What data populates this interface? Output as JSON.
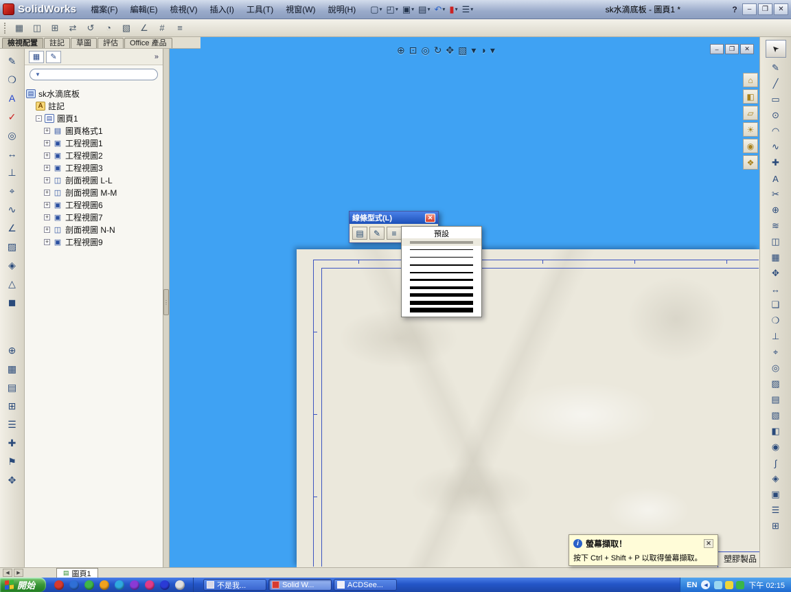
{
  "colors": {
    "viewport_blue": "#3fa2f3",
    "paper": "#ebe8dc",
    "frame_line": "#3b53c0",
    "taskbar_blue": "#2456c8",
    "start_green": "#3a9638",
    "dialog_caption_blue": "#1c50b8",
    "notification_yellow": "#fffcd8"
  },
  "glyphs": {
    "caret": "▾",
    "expand": "+",
    "collapse": "-",
    "chevrons": "»",
    "funnel": "▼",
    "doc_icon": "▤",
    "sheet_icon": "▤",
    "annotations_icon": "A",
    "fm_tab1": "▦",
    "fm_tab2": "✎",
    "cursor": "➤",
    "grip_dots": "⋮",
    "info": "i",
    "tray_chevron": "◀",
    "nav_left": "◀",
    "nav_right": "▶"
  },
  "app": {
    "brand": "SolidWorks",
    "window_title": "sk水滴底板 - 圖頁1 *",
    "help": "?"
  },
  "window_controls": {
    "minimize": "–",
    "restore": "❐",
    "close": "✕"
  },
  "menu": [
    "檔案(F)",
    "編輯(E)",
    "檢視(V)",
    "插入(I)",
    "工具(T)",
    "視窗(W)",
    "說明(H)"
  ],
  "titlebar_tools": [
    {
      "name": "new-document",
      "glyph": "▢"
    },
    {
      "name": "open-document",
      "glyph": "◰"
    },
    {
      "name": "save-document",
      "glyph": "▣"
    },
    {
      "name": "print-document",
      "glyph": "▤"
    },
    {
      "name": "undo",
      "glyph": "↶",
      "color": "#2a62c8"
    },
    {
      "name": "rebuild",
      "glyph": "▮",
      "color": "#cc2222"
    },
    {
      "name": "options",
      "glyph": "☰"
    }
  ],
  "toolbar2": [
    {
      "name": "grid",
      "glyph": "▦"
    },
    {
      "name": "picture",
      "glyph": "◫"
    },
    {
      "name": "table",
      "glyph": "⊞"
    },
    {
      "name": "swap-arrows",
      "glyph": "⇄"
    },
    {
      "name": "rotate",
      "glyph": "↺"
    },
    {
      "name": "arc-tool",
      "glyph": "◔"
    },
    {
      "name": "hatch",
      "glyph": "▧"
    },
    {
      "name": "angle",
      "glyph": "∠"
    },
    {
      "name": "numbering",
      "glyph": "#"
    },
    {
      "name": "list",
      "glyph": "≡"
    }
  ],
  "command_tabs": [
    {
      "label": "檢視配置",
      "active": true
    },
    {
      "label": "註記"
    },
    {
      "label": "草圖"
    },
    {
      "label": "評估"
    },
    {
      "label": "Office 產品"
    }
  ],
  "left_toolbar_top": [
    {
      "name": "note",
      "glyph": "✎"
    },
    {
      "name": "balloon",
      "glyph": "❍"
    },
    {
      "name": "text",
      "glyph": "A",
      "color": "#2244cc"
    },
    {
      "name": "spellcheck",
      "glyph": "✓",
      "color": "#cc2222"
    },
    {
      "name": "magnifier",
      "glyph": "◎"
    },
    {
      "name": "dimension",
      "glyph": "↔"
    },
    {
      "name": "datum",
      "glyph": "⊥"
    },
    {
      "name": "tolerance",
      "glyph": "⌖"
    },
    {
      "name": "surface-finish",
      "glyph": "∿"
    },
    {
      "name": "weld-symbol",
      "glyph": "∠"
    },
    {
      "name": "area-hatch",
      "glyph": "▨"
    },
    {
      "name": "block",
      "glyph": "◈"
    },
    {
      "name": "datum-triangle",
      "glyph": "△"
    },
    {
      "name": "fill",
      "glyph": "◼"
    }
  ],
  "left_toolbar_bottom": [
    {
      "name": "center-mark",
      "glyph": "⊕"
    },
    {
      "name": "general-table",
      "glyph": "▦"
    },
    {
      "name": "revision-table",
      "glyph": "▤"
    },
    {
      "name": "hole-table",
      "glyph": "⊞"
    },
    {
      "name": "bom-table",
      "glyph": "☰"
    },
    {
      "name": "pin",
      "glyph": "✚"
    },
    {
      "name": "flag",
      "glyph": "⚑"
    },
    {
      "name": "move",
      "glyph": "✥"
    }
  ],
  "right_toolbar": [
    {
      "name": "sketch",
      "glyph": "✎"
    },
    {
      "name": "line",
      "glyph": "╱"
    },
    {
      "name": "rectangle",
      "glyph": "▭"
    },
    {
      "name": "circle",
      "glyph": "⊙"
    },
    {
      "name": "arc",
      "glyph": "◠"
    },
    {
      "name": "spline",
      "glyph": "∿"
    },
    {
      "name": "point",
      "glyph": "✚"
    },
    {
      "name": "text",
      "glyph": "A"
    },
    {
      "name": "trim",
      "glyph": "✂"
    },
    {
      "name": "convert-entities",
      "glyph": "⊕"
    },
    {
      "name": "offset",
      "glyph": "≋"
    },
    {
      "name": "mirror",
      "glyph": "◫"
    },
    {
      "name": "linear-pattern",
      "glyph": "▦"
    },
    {
      "name": "move-entities",
      "glyph": "✥"
    },
    {
      "name": "smart-dimension",
      "glyph": "↔"
    },
    {
      "name": "note",
      "glyph": "❑"
    },
    {
      "name": "balloon",
      "glyph": "❍"
    },
    {
      "name": "datum-feature",
      "glyph": "⊥"
    },
    {
      "name": "geometric-tolerance",
      "glyph": "⌖"
    },
    {
      "name": "center-mark",
      "glyph": "◎"
    },
    {
      "name": "area-hatch",
      "glyph": "▨"
    },
    {
      "name": "tables",
      "glyph": "▤"
    },
    {
      "name": "model-view",
      "glyph": "▧"
    },
    {
      "name": "section-view",
      "glyph": "◧"
    },
    {
      "name": "detail-view",
      "glyph": "◉"
    },
    {
      "name": "break-view",
      "glyph": "∫"
    },
    {
      "name": "block",
      "glyph": "◈"
    },
    {
      "name": "revision",
      "glyph": "▣"
    },
    {
      "name": "layers",
      "glyph": "☰"
    },
    {
      "name": "grid-settings",
      "glyph": "⊞"
    }
  ],
  "minibar": [
    {
      "name": "home",
      "glyph": "⌂"
    },
    {
      "name": "display-style",
      "glyph": "◧"
    },
    {
      "name": "folder",
      "glyph": "▱"
    },
    {
      "name": "lighting",
      "glyph": "☀"
    },
    {
      "name": "material",
      "glyph": "◉"
    },
    {
      "name": "appearance",
      "glyph": "❖"
    }
  ],
  "viewtools": [
    {
      "name": "zoom-in",
      "glyph": "⊕"
    },
    {
      "name": "zoom-area",
      "glyph": "⊡"
    },
    {
      "name": "zoom-fit",
      "glyph": "◎"
    },
    {
      "name": "rotate-view",
      "glyph": "↻"
    },
    {
      "name": "pan",
      "glyph": "✥"
    },
    {
      "name": "view-orientation",
      "glyph": "▧"
    },
    {
      "name": "view-orientation-caret",
      "glyph": "▾"
    },
    {
      "name": "display-style",
      "glyph": "◑"
    },
    {
      "name": "display-style-caret",
      "glyph": "▾"
    }
  ],
  "tree": {
    "root": "sk水滴底板",
    "annotations": "註記",
    "sheet": "圖頁1",
    "children": [
      {
        "label": "圖頁格式1",
        "glyph": "▤"
      },
      {
        "label": "工程視圖1",
        "glyph": "▣"
      },
      {
        "label": "工程視圖2",
        "glyph": "▣"
      },
      {
        "label": "工程視圖3",
        "glyph": "▣"
      },
      {
        "label": "剖面視圖 L-L",
        "glyph": "◫"
      },
      {
        "label": "剖面視圖 M-M",
        "glyph": "◫"
      },
      {
        "label": "工程視圖6",
        "glyph": "▣"
      },
      {
        "label": "工程視圖7",
        "glyph": "▣"
      },
      {
        "label": "剖面視圖 N-N",
        "glyph": "◫"
      },
      {
        "label": "工程視圖9",
        "glyph": "▣"
      }
    ]
  },
  "line_style": {
    "title": "線條型式(L)",
    "close": "✕",
    "buttons": [
      {
        "name": "layer-properties",
        "glyph": "▤"
      },
      {
        "name": "line-color",
        "glyph": "✎"
      },
      {
        "name": "line-thickness",
        "glyph": "≡"
      }
    ],
    "dropdown_header": "預設",
    "weights": [
      {
        "h": 4,
        "default": true
      },
      1,
      1,
      2,
      2,
      3,
      4,
      5,
      6,
      7
    ]
  },
  "notification": {
    "title": "螢幕擷取！",
    "body": "按下 Ctrl + Shift + P 以取得螢幕擷取。",
    "close": "✕"
  },
  "sheet_area": {
    "title_block": "塑膠製品"
  },
  "sheet_strip": {
    "tab": "圖頁1"
  },
  "taskbar": {
    "start": "開始",
    "quick_launch": [
      "#d63a2f",
      "#2f6fd6",
      "#3fb54a",
      "#f0a21e",
      "#2fa9e0",
      "#8a3ad6",
      "#e03a8a",
      "#2a3ad6",
      "#e0e0e0"
    ],
    "tasks": [
      {
        "label": "不是我...",
        "color": "#d8d8e8"
      },
      {
        "label": "Solid W...",
        "color": "#d63a2f",
        "active": true
      },
      {
        "label": "ACDSee...",
        "color": "#f0f0f8"
      }
    ],
    "tray": {
      "lang": "EN",
      "icons": [
        "#9ad6f0",
        "#f0d63a",
        "#3ab54a"
      ],
      "time": "下午 02:15"
    }
  }
}
